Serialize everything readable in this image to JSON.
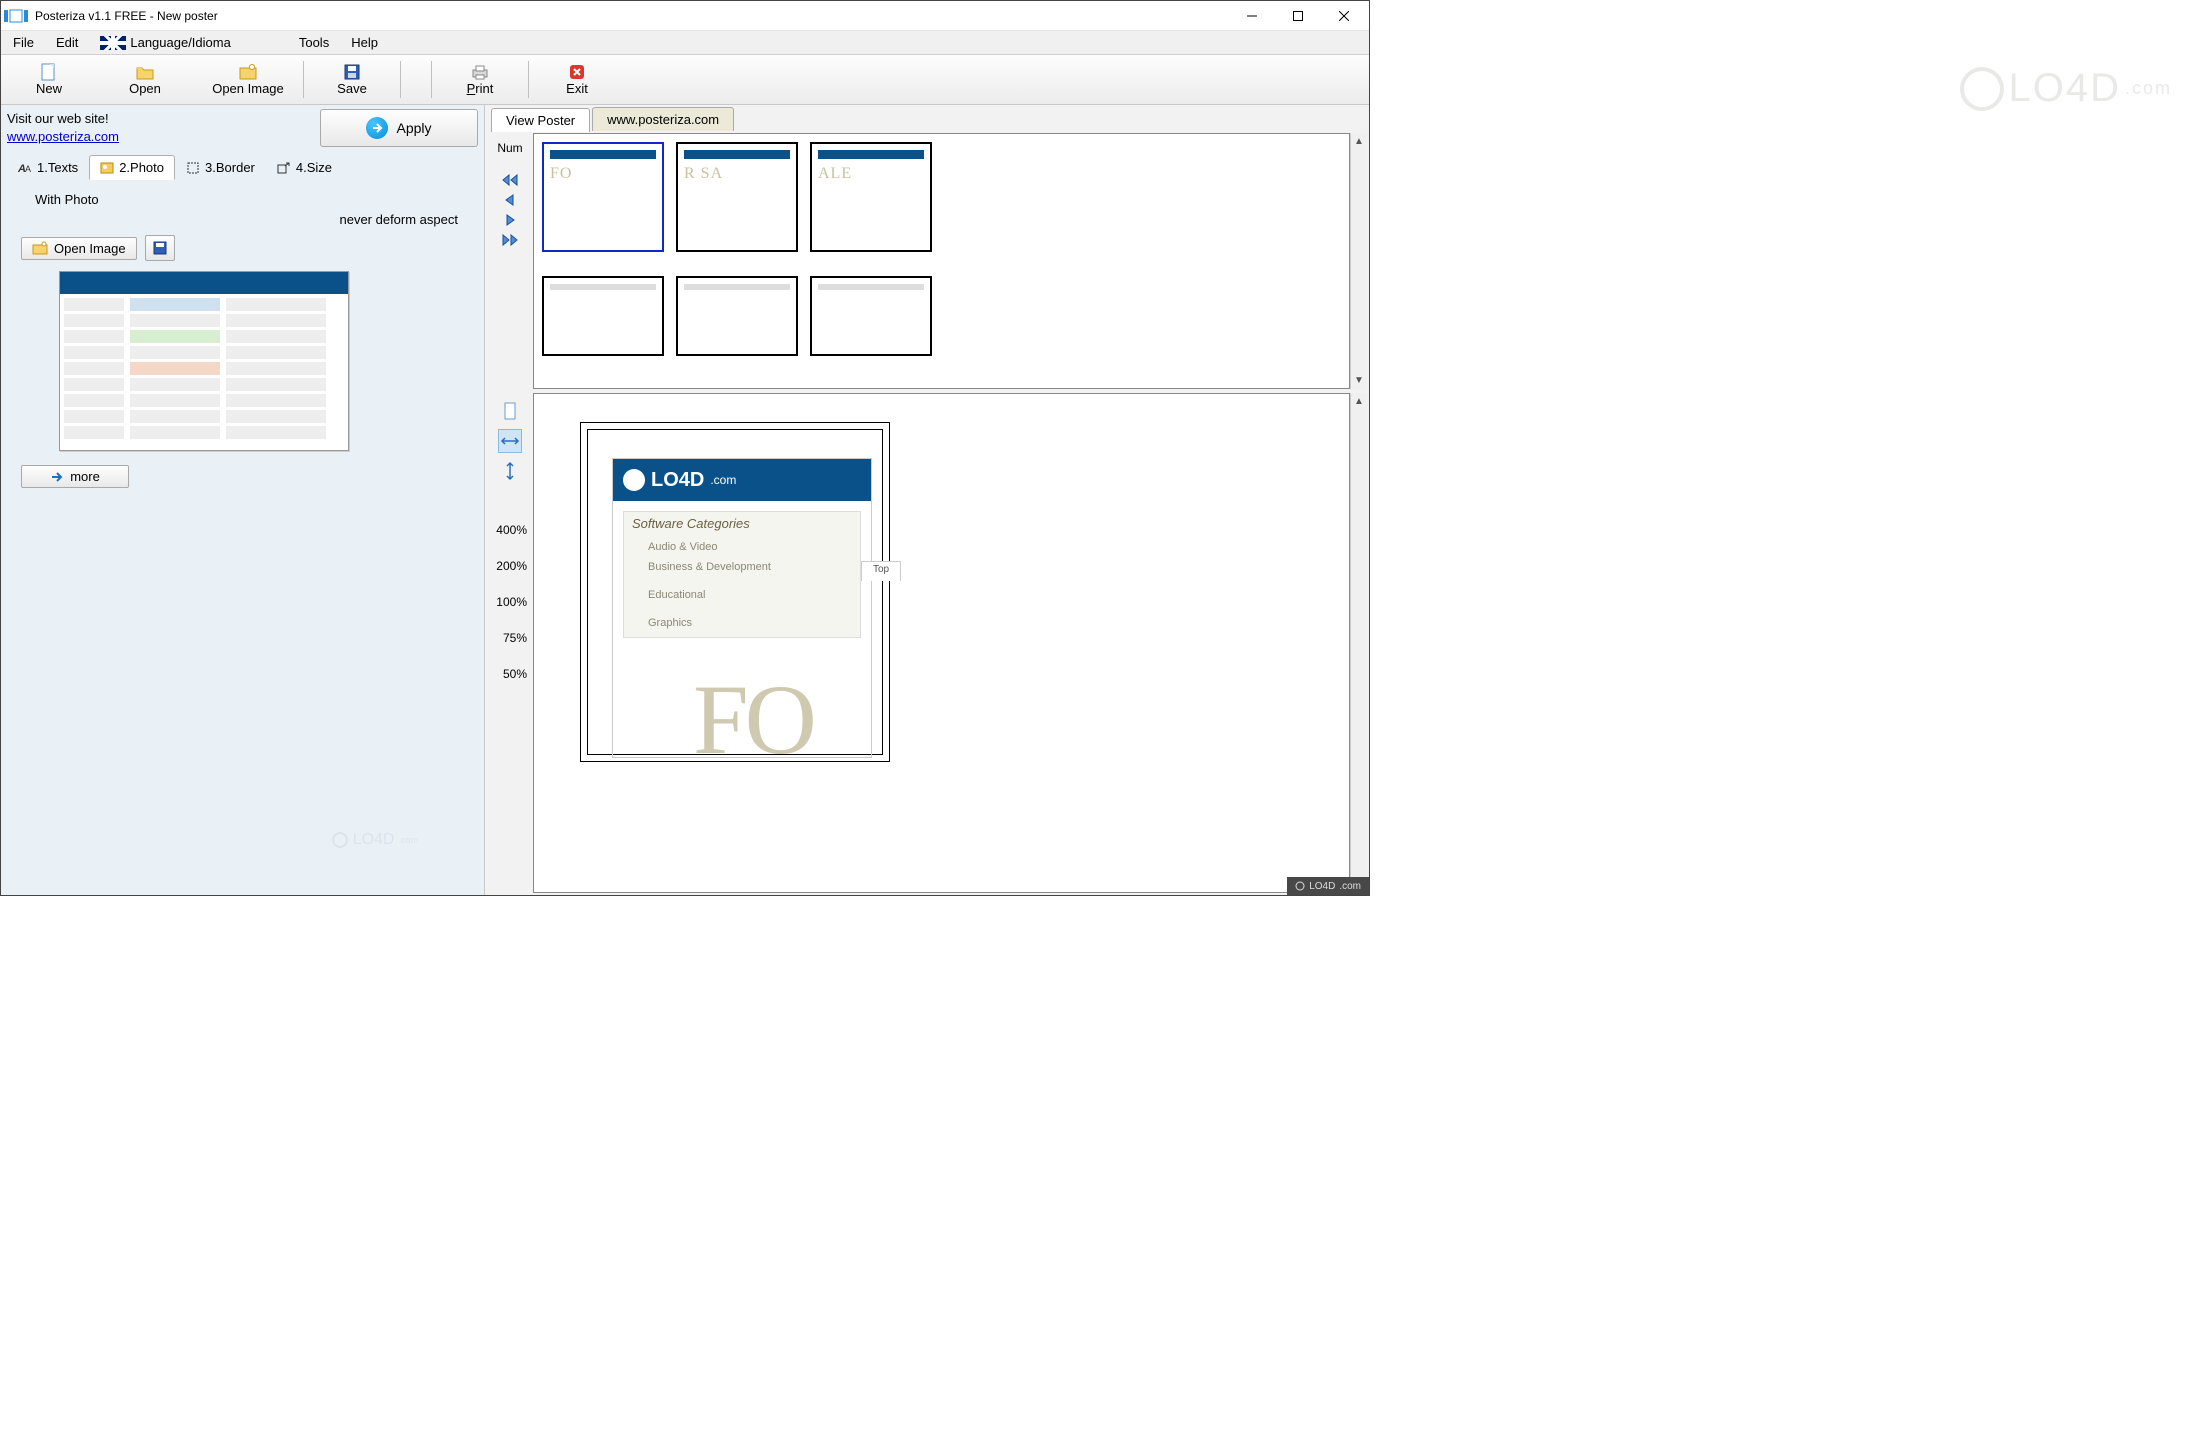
{
  "window": {
    "title": "Posteriza v1.1 FREE - New poster"
  },
  "menubar": {
    "file": "File",
    "edit": "Edit",
    "language": "Language/Idioma",
    "tools": "Tools",
    "help": "Help"
  },
  "toolbar": {
    "new": "New",
    "open": "Open",
    "open_image": "Open Image",
    "save": "Save",
    "print": "Print",
    "print_key": "P",
    "exit": "Exit"
  },
  "left": {
    "visit_text": "Visit our web site!",
    "site_url": "www.posteriza.com",
    "apply": "Apply",
    "tabs": {
      "texts": "1.Texts",
      "photo": "2.Photo",
      "border": "3.Border",
      "size": "4.Size"
    },
    "with_photo": "With Photo",
    "never_deform": "never deform aspect",
    "open_image_btn": "Open Image",
    "more": "more"
  },
  "right": {
    "tabs": {
      "view_poster": "View Poster",
      "web": "www.posteriza.com"
    },
    "num_label": "Num",
    "tiles_top_text": [
      "FO",
      "R SA",
      "ALE"
    ],
    "zoom_levels": [
      "400%",
      "200%",
      "100%",
      "75%",
      "50%"
    ],
    "detail_brand": "LO4D",
    "detail_brand_suffix": ".com",
    "detail_heading": "Software Categories",
    "detail_cats": [
      "Audio & Video",
      "Business & Development",
      "",
      "Educational",
      "",
      "Graphics"
    ],
    "detail_top_tab": "Top",
    "big_letters": "FO"
  },
  "watermark": {
    "brand": "LO4D",
    "suffix": ".com"
  }
}
